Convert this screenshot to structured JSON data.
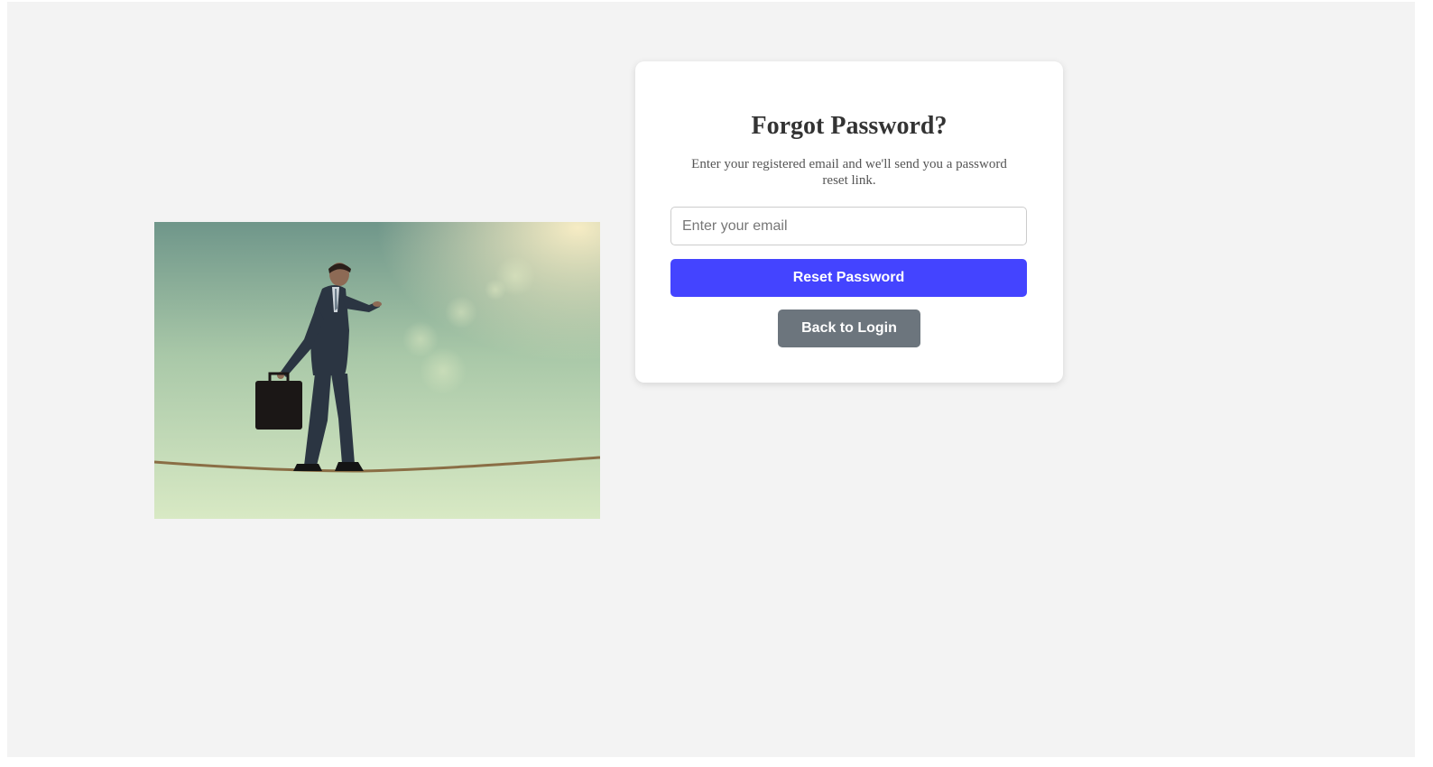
{
  "hero": {
    "image_alt": "Businessman with briefcase walking on a tightrope",
    "icon": "tightrope-businessman-illustration"
  },
  "card": {
    "title": "Forgot Password?",
    "description": "Enter your registered email and we'll send you a password reset link.",
    "email": {
      "value": "",
      "placeholder": "Enter your email"
    },
    "reset_label": "Reset Password",
    "back_label": "Back to Login"
  },
  "colors": {
    "page_bg": "#f3f3f3",
    "card_bg": "#ffffff",
    "primary": "#4444ff",
    "secondary": "#6c757d",
    "title": "#333333",
    "text": "#555555"
  }
}
